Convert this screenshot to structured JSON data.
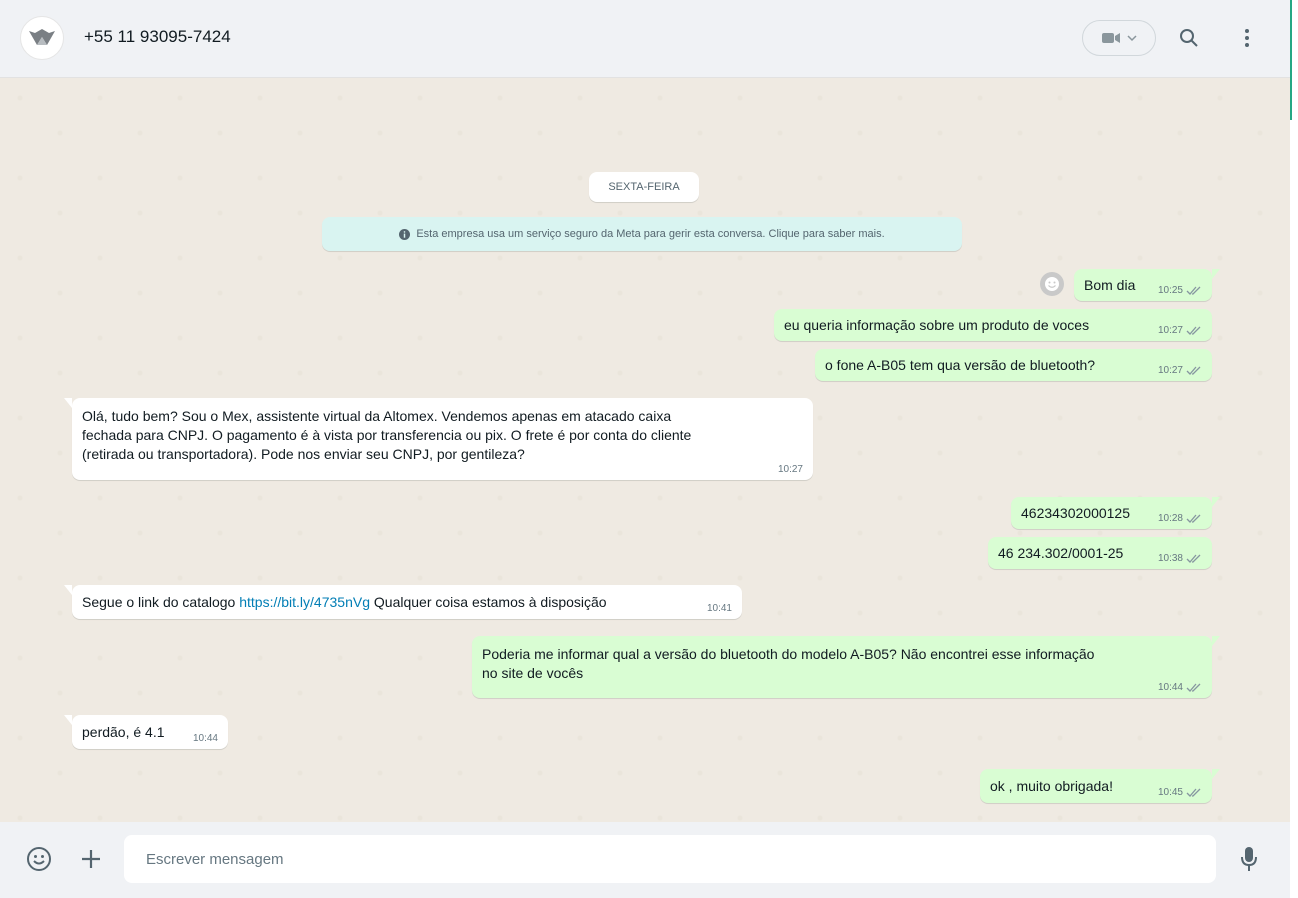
{
  "header": {
    "contact_name": "+55 11 93095-7424",
    "icons": [
      "logo-avatar",
      "video-call-icon",
      "chevron-down-icon",
      "search-icon",
      "menu-icon"
    ]
  },
  "chat": {
    "date_label": "SEXTA-FEIRA",
    "system_message": "Esta empresa usa um serviço seguro da Meta para gerir esta conversa. Clique para saber mais.",
    "messages": [
      {
        "direction": "out",
        "text": "Bom dia",
        "time": "10:25"
      },
      {
        "direction": "out",
        "text": "eu queria informação sobre um produto de voces",
        "time": "10:27"
      },
      {
        "direction": "out",
        "text": "o fone A-B05 tem qua versão de bluetooth?",
        "time": "10:27"
      },
      {
        "direction": "in",
        "lines": [
          "Olá, tudo bem? Sou o Mex, assistente virtual da Altomex. Vendemos apenas em atacado caixa",
          "fechada para CNPJ. O pagamento é à vista por transferencia ou pix. O frete é por conta do cliente",
          "(retirada ou transportadora). Pode nos enviar seu CNPJ, por gentileza?"
        ],
        "time": "10:27"
      },
      {
        "direction": "out",
        "text": "46234302000125",
        "time": "10:28"
      },
      {
        "direction": "out",
        "text": "46 234.302/0001-25",
        "time": "10:38"
      },
      {
        "direction": "in",
        "text_before": "Segue o link do catalogo ",
        "link": "https://bit.ly/4735nVg",
        "text_after": " Qualquer coisa estamos à disposição",
        "time": "10:41"
      },
      {
        "direction": "out",
        "lines": [
          "Poderia me informar qual a versão do bluetooth do modelo A-B05? Não encontrei esse informação",
          "no site de vocês"
        ],
        "time": "10:44"
      },
      {
        "direction": "in",
        "text": "perdão, é 4.1",
        "time": "10:44"
      },
      {
        "direction": "out",
        "text": "ok , muito obrigada!",
        "time": "10:45"
      }
    ]
  },
  "composer": {
    "placeholder": "Escrever mensagem"
  },
  "colors": {
    "outgoing_bubble": "#d9fdd3",
    "incoming_bubble": "#ffffff",
    "chat_background": "#efeae2",
    "system_bubble": "#d9f4f1",
    "link": "#027eb5",
    "read_ticks": "#8696a0"
  }
}
